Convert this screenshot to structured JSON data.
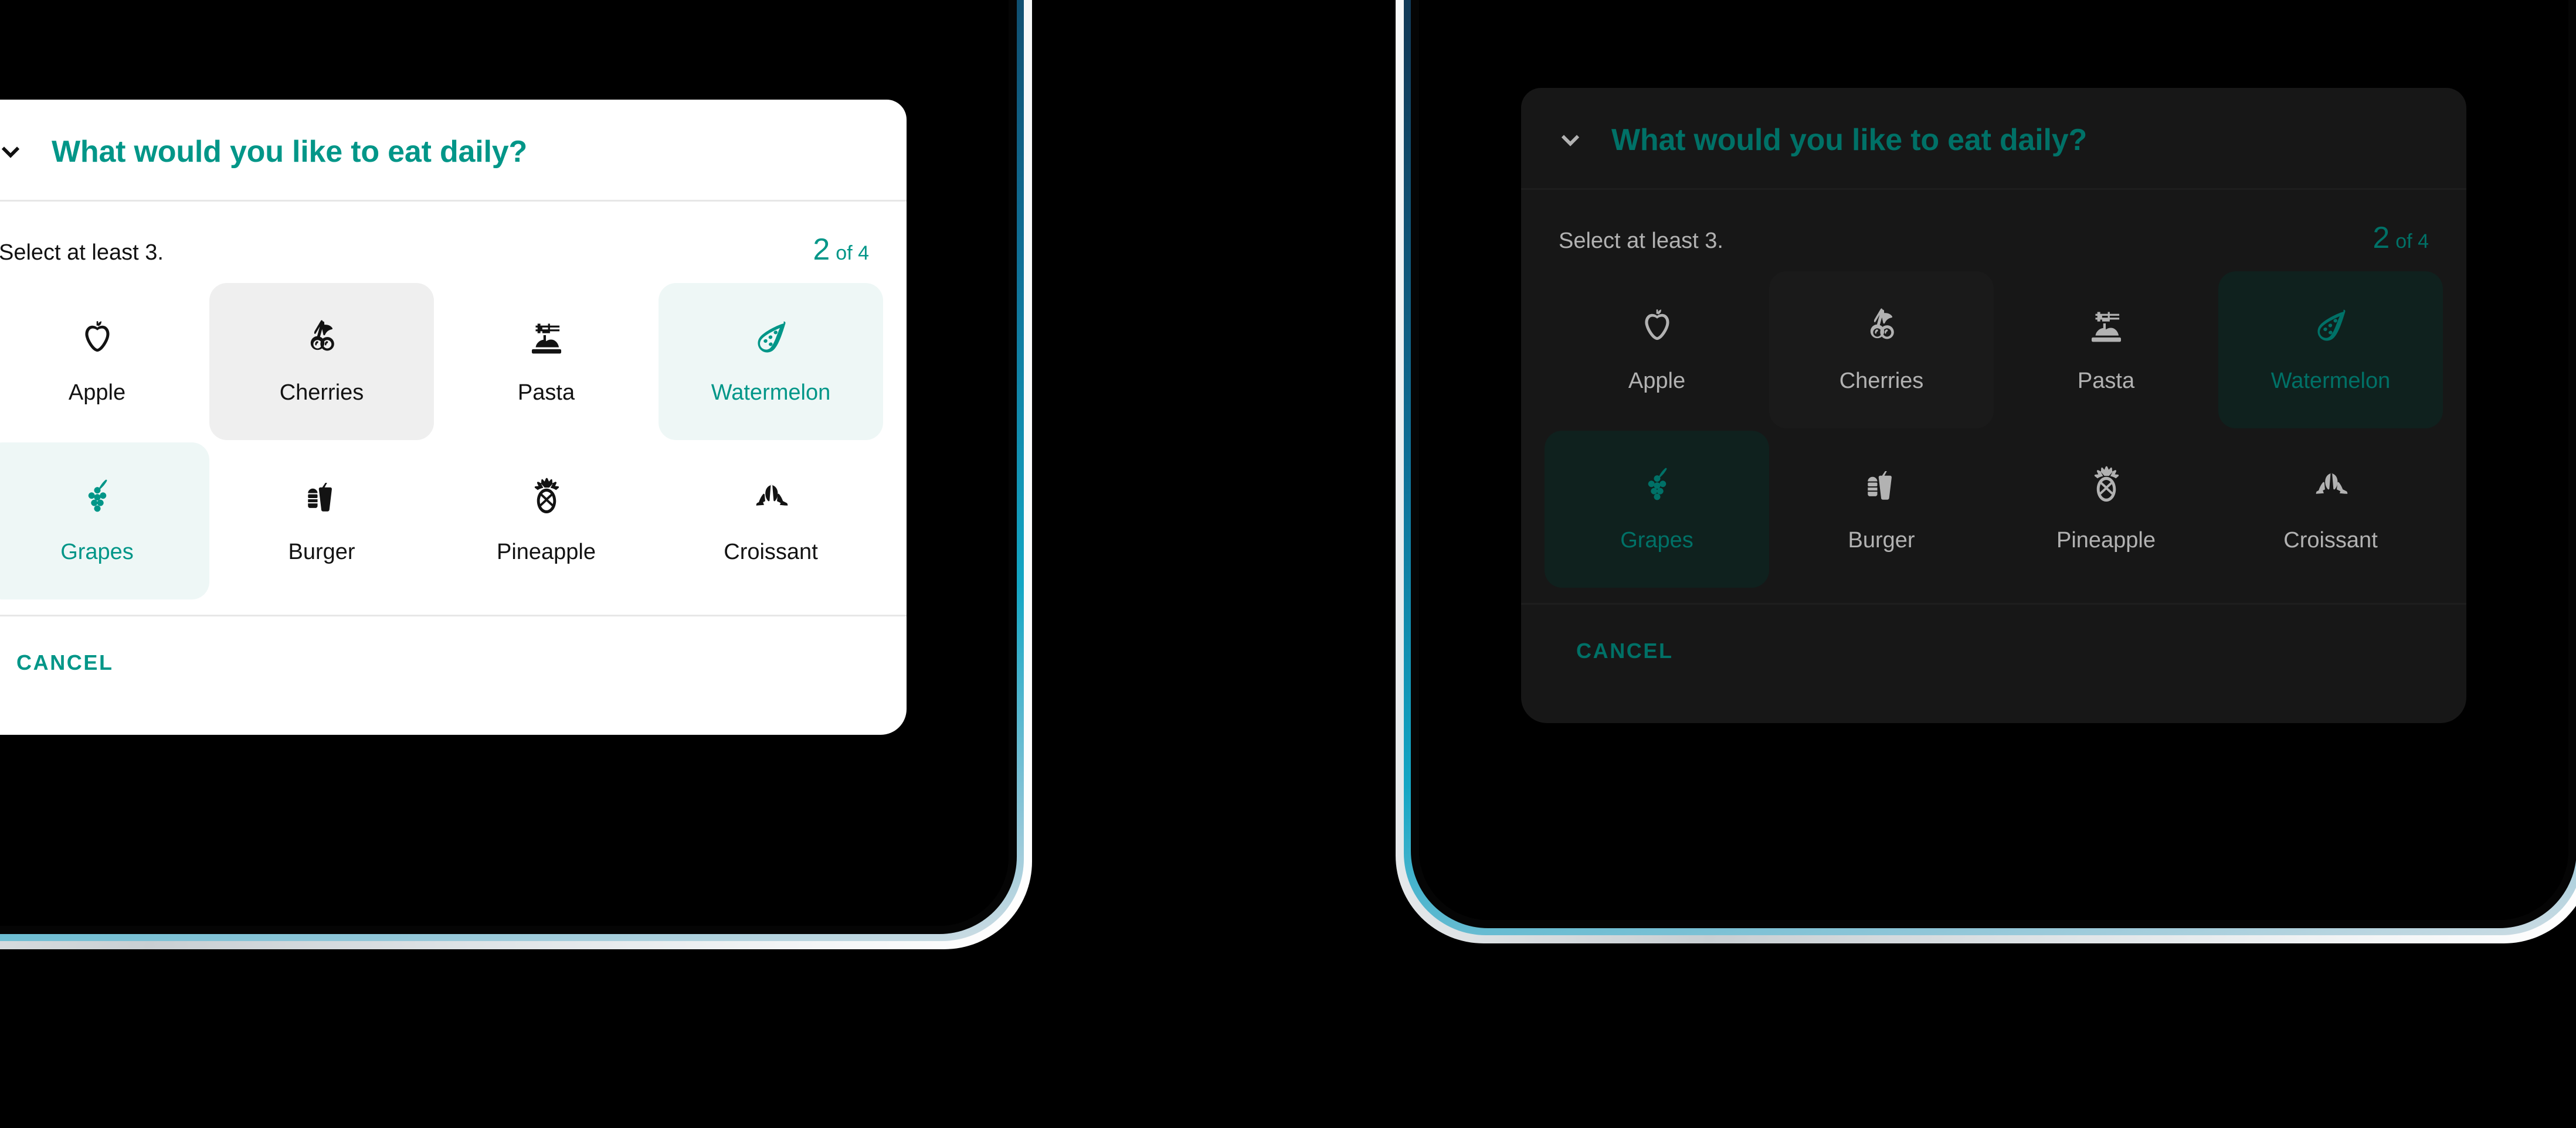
{
  "theme_colors": {
    "accent_light": "#009688",
    "accent_dark": "#00a294",
    "card_light": "#ffffff",
    "card_dark": "#212121",
    "selected_bg_light": "#eef7f6",
    "selected_bg_dark": "#16302c",
    "hover_bg_light": "#efefef",
    "hover_bg_dark": "#262626",
    "divider_light": "#e7e7e7",
    "divider_dark": "#2c2c2c",
    "screen_background": "#000000"
  },
  "dialog": {
    "collapse_icon": "chevron-down-icon",
    "title": "What would you like to eat daily?",
    "helper_text": "Select at least 3.",
    "counter": {
      "current": "2",
      "suffix": "of 4"
    },
    "cancel_label": "CANCEL",
    "choices": [
      {
        "label": "Apple",
        "icon": "apple-icon",
        "state": "default"
      },
      {
        "label": "Cherries",
        "icon": "cherries-icon",
        "state": "hover"
      },
      {
        "label": "Pasta",
        "icon": "pasta-icon",
        "state": "default"
      },
      {
        "label": "Watermelon",
        "icon": "watermelon-icon",
        "state": "selected"
      },
      {
        "label": "Grapes",
        "icon": "grapes-icon",
        "state": "selected"
      },
      {
        "label": "Burger",
        "icon": "burger-icon",
        "state": "default"
      },
      {
        "label": "Pineapple",
        "icon": "pineapple-icon",
        "state": "default"
      },
      {
        "label": "Croissant",
        "icon": "croissant-icon",
        "state": "default"
      }
    ]
  },
  "variants": [
    {
      "id": "phone-light",
      "name": "light-theme-device"
    },
    {
      "id": "phone-dark",
      "name": "dark-theme-device"
    }
  ]
}
